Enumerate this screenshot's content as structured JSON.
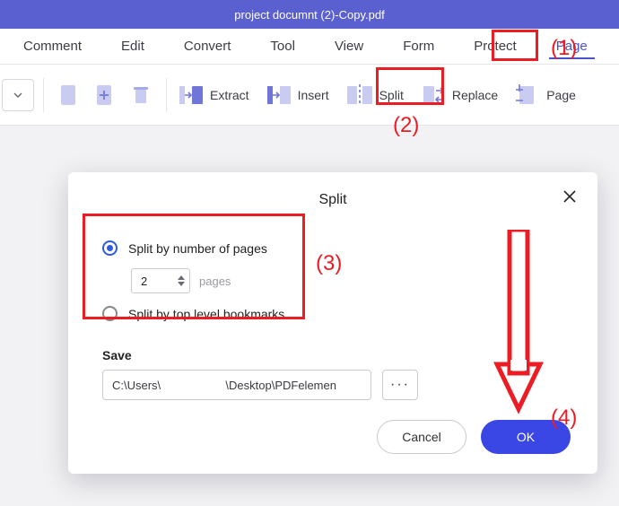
{
  "titlebar": {
    "filename": "project documnt (2)-Copy.pdf"
  },
  "menu": {
    "items": [
      "Comment",
      "Edit",
      "Convert",
      "Tool",
      "View",
      "Form",
      "Protect",
      "Page"
    ],
    "active_index": 7
  },
  "toolbar": {
    "extract_label": "Extract",
    "insert_label": "Insert",
    "split_label": "Split",
    "replace_label": "Replace",
    "page_label": "Page"
  },
  "dialog": {
    "title": "Split",
    "close_label": "Close",
    "opt1_label": "Split by number of pages",
    "opt2_label": "Split by top level bookmarks",
    "pages_value": "2",
    "pages_unit": "pages",
    "save_label": "Save",
    "path_value": "C:\\Users\\                    \\Desktop\\PDFelemen",
    "browse_label": "···",
    "cancel_label": "Cancel",
    "ok_label": "OK"
  },
  "annotations": {
    "n1": "(1)",
    "n2": "(2)",
    "n3": "(3)",
    "n4": "(4)"
  },
  "colors": {
    "accent": "#4a52d0",
    "primary_btn": "#3a47e4",
    "highlight": "#eb1c24",
    "titlebar": "#5b60d0"
  }
}
